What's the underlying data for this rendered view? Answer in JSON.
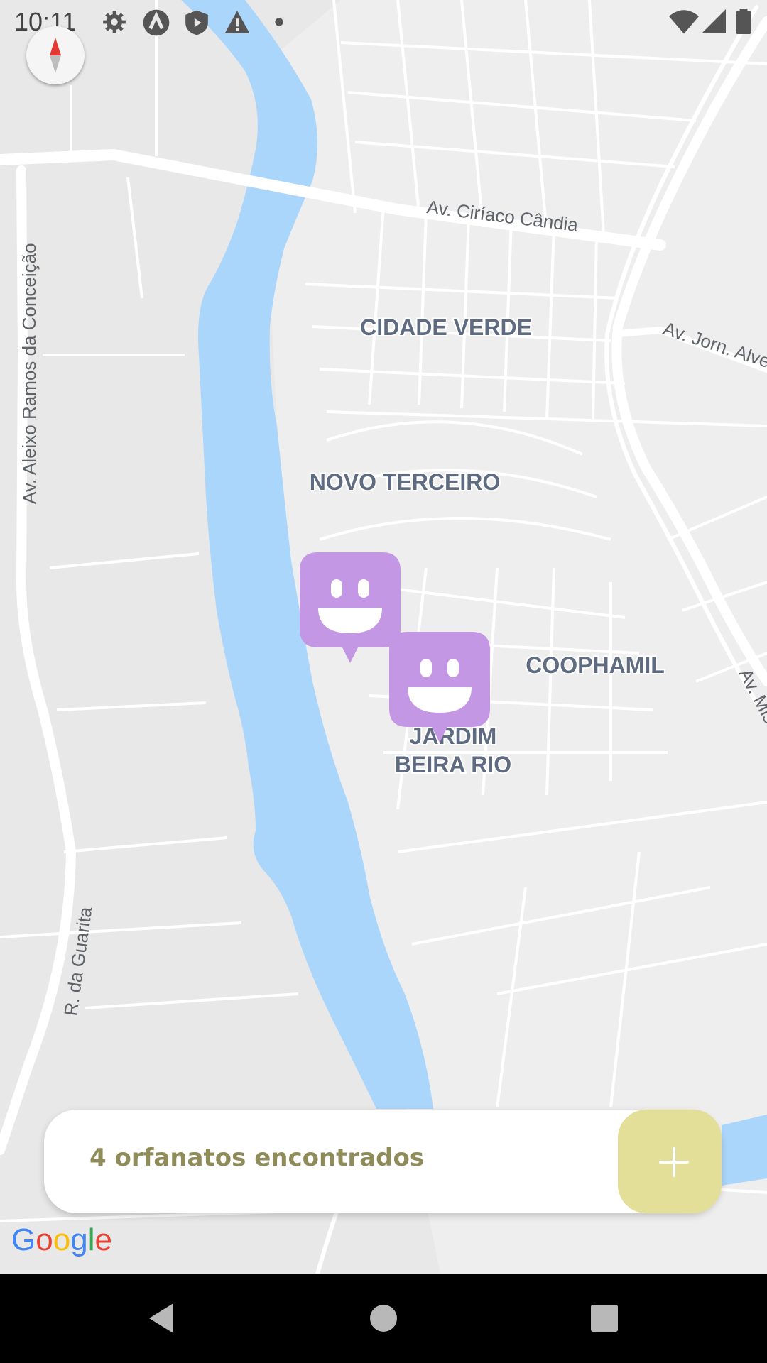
{
  "status_bar": {
    "time": "10:11",
    "icons": [
      "gear-icon",
      "app-icon",
      "shield-play-icon",
      "warning-icon",
      "dot-icon",
      "wifi-icon",
      "signal-icon",
      "battery-icon"
    ]
  },
  "map": {
    "street_labels": {
      "ciriaco": "Av. Ciríaco Cândia",
      "jorn": "Av. Jorn. Alves",
      "aleixo": "Av. Aleixo Ramos da Conceição",
      "guarita": "R. da Guarita",
      "mis": "Av. Mis"
    },
    "area_labels": {
      "cidade_verde": "CIDADE VERDE",
      "novo_terceiro": "NOVO TERCEIRO",
      "coophamil": "COOPHAMIL",
      "jardim_1": "JARDIM",
      "jardim_2": "BEIRA RIO"
    },
    "colors": {
      "land": "#e8e8e8",
      "water": "#abd6fb",
      "road": "#ffffff",
      "marker": "#c497e5"
    },
    "compass_icon": "compass-icon",
    "marker_icon": "smile-marker-icon"
  },
  "footer": {
    "text": "4 orfanatos encontrados",
    "add_label": "+",
    "button_color": "#e3df99"
  },
  "attribution": {
    "letters": [
      "G",
      "o",
      "o",
      "g",
      "l",
      "e"
    ],
    "colors": [
      "#4285f4",
      "#ea4335",
      "#fbbc05",
      "#4285f4",
      "#34a853",
      "#ea4335"
    ]
  },
  "nav_bar": {
    "back_icon": "back-icon",
    "home_icon": "home-icon",
    "recents_icon": "recents-icon"
  }
}
